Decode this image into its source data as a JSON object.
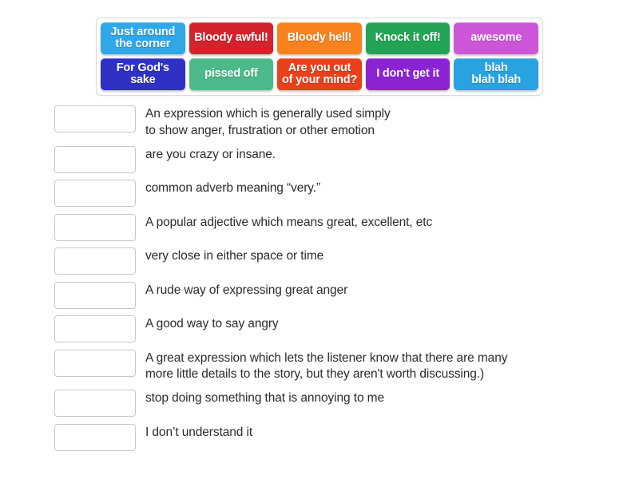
{
  "activity": {
    "type": "match-up",
    "tile_bank": {
      "label": "draggable answer tiles",
      "rows": [
        [
          {
            "label": "Just around the corner",
            "lines": [
              "Just around",
              "the corner"
            ],
            "color": "#2fa8e8"
          },
          {
            "label": "Bloody awful!",
            "lines": [
              "Bloody awful!"
            ],
            "color": "#d5232c"
          },
          {
            "label": "Bloody hell!",
            "lines": [
              "Bloody hell!"
            ],
            "color": "#f7821e"
          },
          {
            "label": "Knock it off!",
            "lines": [
              "Knock it off!"
            ],
            "color": "#23a455"
          },
          {
            "label": "awesome",
            "lines": [
              "awesome"
            ],
            "color": "#cd56d8"
          }
        ],
        [
          {
            "label": "For God's sake",
            "lines": [
              "For God's",
              "sake"
            ],
            "color": "#2e31c4"
          },
          {
            "label": "pissed off",
            "lines": [
              "pissed off"
            ],
            "color": "#4cb98a"
          },
          {
            "label": "Are you out of your mind?",
            "lines": [
              "Are you out",
              "of your mind?"
            ],
            "color": "#e8401a"
          },
          {
            "label": "I don't get it",
            "lines": [
              "I don't get it"
            ],
            "color": "#8b22d4"
          },
          {
            "label": "blah blah blah",
            "lines": [
              "blah",
              "blah blah"
            ],
            "color": "#29a3e0"
          }
        ]
      ]
    },
    "definitions": [
      {
        "box_value": "",
        "box_placeholder": "",
        "lines": [
          "An expression which is generally used simply",
          "to show anger, frustration or other emotion"
        ]
      },
      {
        "box_value": "",
        "box_placeholder": "",
        "lines": [
          "are you crazy or insane."
        ]
      },
      {
        "box_value": "",
        "box_placeholder": "",
        "lines": [
          "common adverb meaning “very.”"
        ]
      },
      {
        "box_value": "",
        "box_placeholder": "",
        "lines": [
          "A popular adjective which means great, excellent, etc"
        ]
      },
      {
        "box_value": "",
        "box_placeholder": "",
        "lines": [
          "very close in either space or time"
        ]
      },
      {
        "box_value": "",
        "box_placeholder": "",
        "lines": [
          "A rude way of expressing great anger"
        ]
      },
      {
        "box_value": "",
        "box_placeholder": "",
        "lines": [
          "A good way to say angry"
        ]
      },
      {
        "box_value": "",
        "box_placeholder": "",
        "lines": [
          "A great expression which lets the listener know that there are many",
          "more little details to the story, but they aren't worth discussing.)"
        ]
      },
      {
        "box_value": "",
        "box_placeholder": "",
        "lines": [
          "stop doing something that is annoying to me"
        ]
      },
      {
        "box_value": "",
        "box_placeholder": "",
        "lines": [
          "I don’t understand it"
        ]
      }
    ]
  },
  "colors": {
    "page_background": "#ffffff",
    "bank_border": "#d9d9d9",
    "drop_box_border": "#c8c8c8",
    "text": "#2b2b2b",
    "tile_text": "#ffffff"
  }
}
